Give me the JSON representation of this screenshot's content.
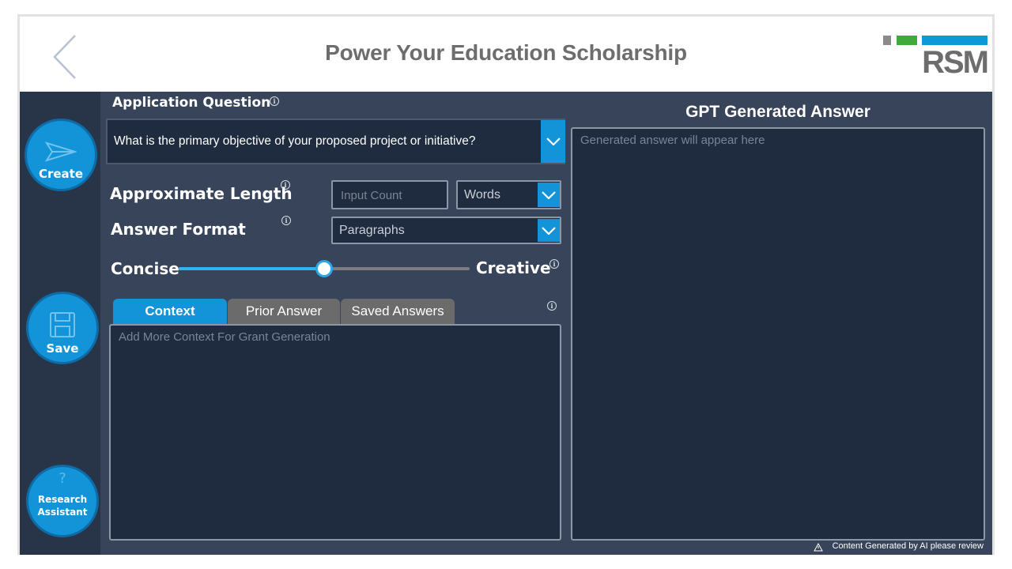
{
  "header": {
    "title": "Power Your Education Scholarship",
    "logo_text": "RSM"
  },
  "rail": {
    "create_label": "Create",
    "save_label": "Save",
    "research_label_line1": "Research",
    "research_label_line2": "Assistant"
  },
  "form": {
    "question_label": "Application Question",
    "question_value": "What is the primary objective of your proposed project or initiative?",
    "length_label": "Approximate Length",
    "length_placeholder": "Input Count",
    "length_unit": "Words",
    "format_label": "Answer Format",
    "format_value": "Paragraphs",
    "slider_left_label": "Concise",
    "slider_right_label": "Creative",
    "slider_value": 0.5
  },
  "tabs": [
    {
      "label": "Context",
      "active": true
    },
    {
      "label": "Prior Answer",
      "active": false
    },
    {
      "label": "Saved Answers",
      "active": false
    }
  ],
  "context": {
    "placeholder": "Add More Context For Grant Generation"
  },
  "answer": {
    "title": "GPT Generated Answer",
    "placeholder": "Generated answer will appear here"
  },
  "footer": {
    "note": "Content Generated by AI please review"
  },
  "colors": {
    "accent": "#1394d8",
    "panel": "#37445a",
    "rail": "#283448",
    "field": "#1f2b3e",
    "brand_green": "#3faa3b",
    "brand_gray": "#6d6d6d"
  },
  "icons": [
    "back-chevron-icon",
    "send-icon",
    "save-disk-icon",
    "question-icon",
    "info-icon",
    "chevron-down-icon",
    "warning-icon"
  ]
}
